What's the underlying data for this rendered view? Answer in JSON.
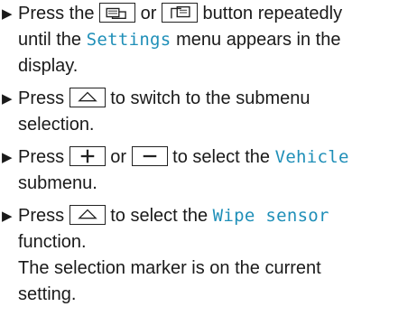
{
  "steps": [
    {
      "l1_pre": "Press the",
      "l1_mid": "or",
      "l1_post": "button repeatedly",
      "l2_pre": "until the",
      "l2_term": "Settings",
      "l2_post": "menu appears in the",
      "l3": "display."
    },
    {
      "l1_pre": "Press",
      "l1_post": "to switch to the submenu",
      "l2": "selection."
    },
    {
      "l1_pre": "Press",
      "l1_mid": "or",
      "l1_post": "to select the",
      "l1_term": "Vehicle",
      "l2": "submenu."
    },
    {
      "l1_pre": "Press",
      "l1_post": "to select the",
      "l1_term": "Wipe sensor",
      "l2": "function.",
      "l3": "The selection marker is on the current",
      "l4": "setting."
    }
  ],
  "icons": {
    "bullet": "right-triangle-bullet",
    "page_back": "page-back-icon",
    "page_forward": "page-forward-icon",
    "up": "up-arrow-icon",
    "plus": "plus-icon",
    "minus": "minus-icon"
  }
}
